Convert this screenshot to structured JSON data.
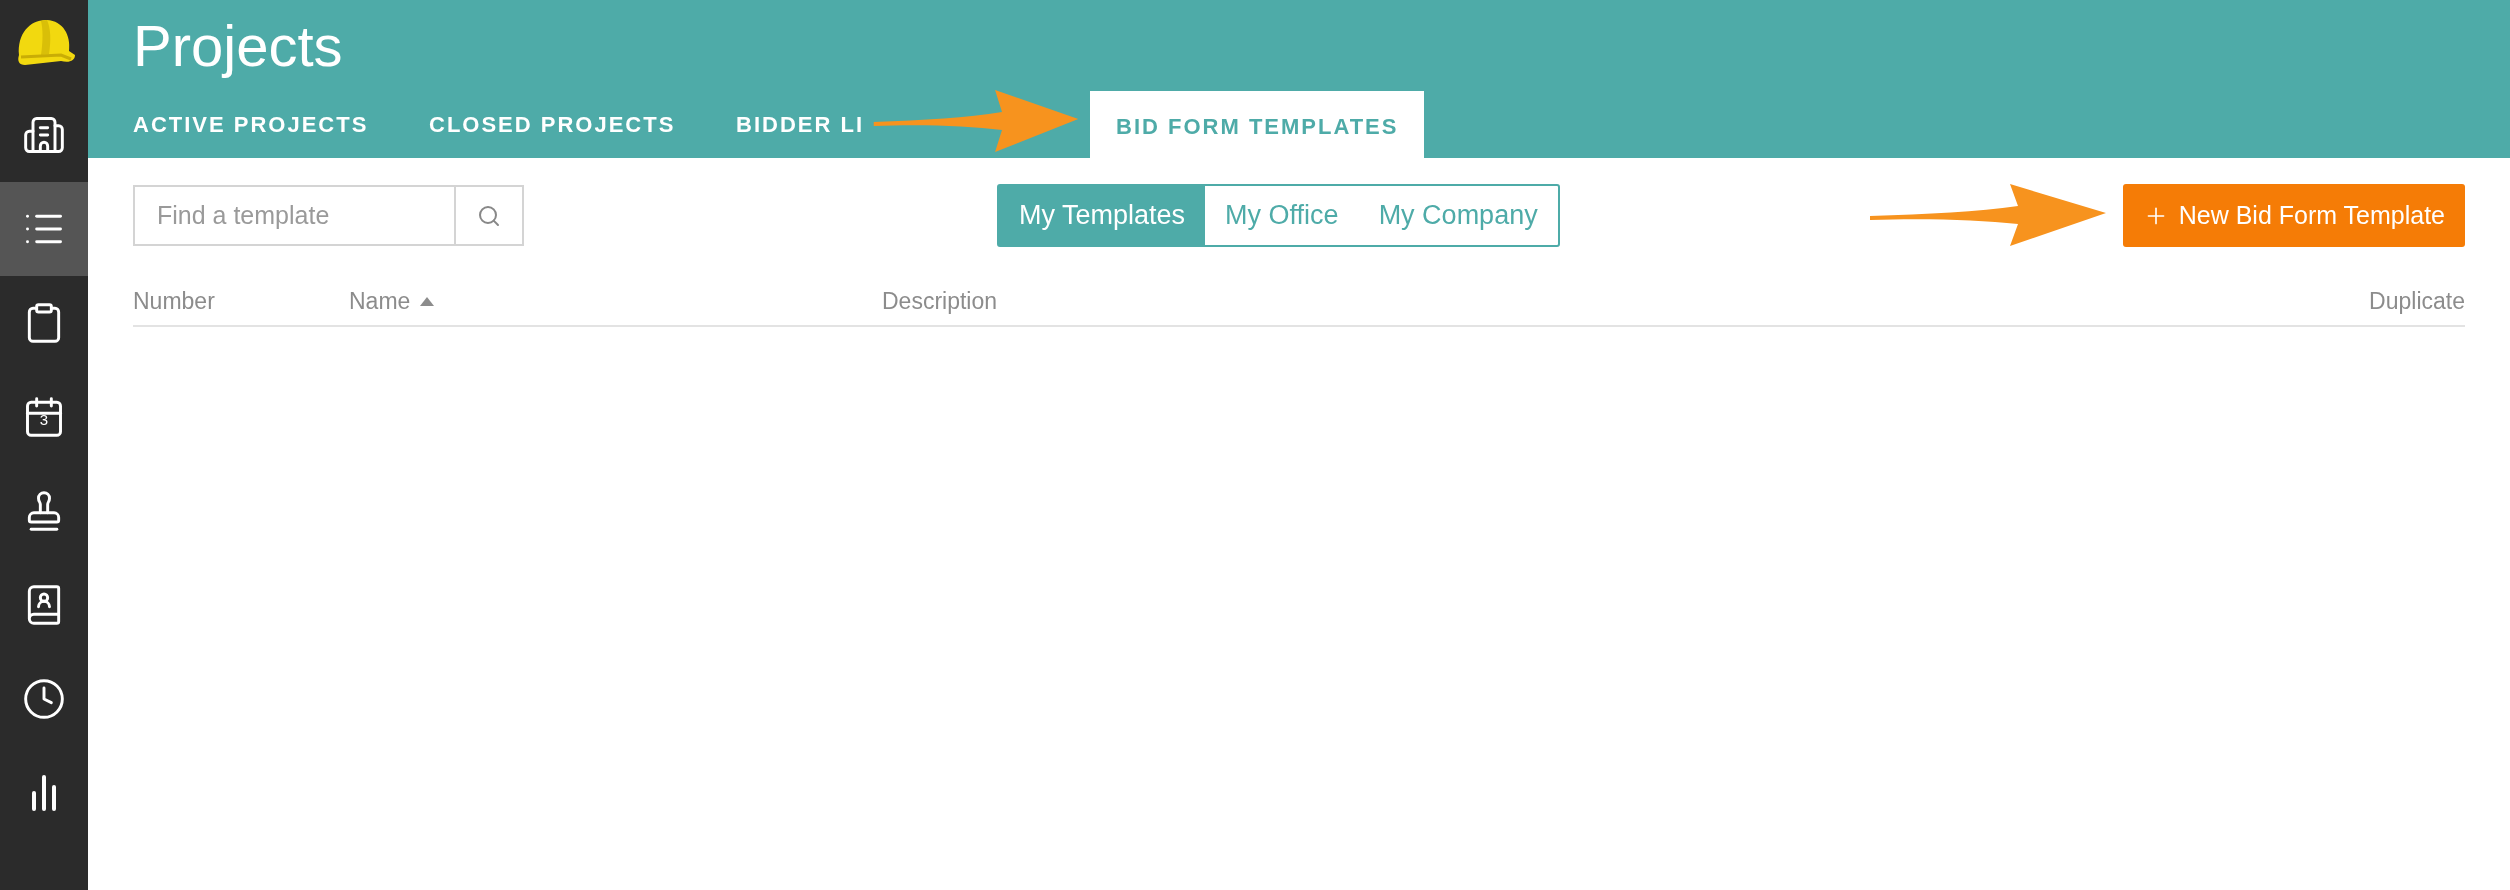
{
  "sidebar": {
    "items": [
      {
        "kind": "buildings",
        "selected": false
      },
      {
        "kind": "list",
        "selected": true
      },
      {
        "kind": "clipboard",
        "selected": false
      },
      {
        "kind": "calendar",
        "selected": false,
        "day": "3"
      },
      {
        "kind": "stamp",
        "selected": false
      },
      {
        "kind": "contacts",
        "selected": false
      },
      {
        "kind": "clock",
        "selected": false
      },
      {
        "kind": "chart",
        "selected": false
      }
    ]
  },
  "header": {
    "title": "Projects"
  },
  "tabs": [
    {
      "label": "ACTIVE PROJECTS",
      "selected": false
    },
    {
      "label": "CLOSED PROJECTS",
      "selected": false
    },
    {
      "label": "BIDDER LI",
      "selected": false
    },
    {
      "label": "BID FORM TEMPLATES",
      "selected": true
    }
  ],
  "search": {
    "placeholder": "Find a template"
  },
  "scope": [
    {
      "label": "My Templates",
      "selected": true
    },
    {
      "label": "My Office",
      "selected": false
    },
    {
      "label": "My Company",
      "selected": false
    }
  ],
  "new_button": {
    "label": "New Bid Form Template"
  },
  "table": {
    "columns": [
      {
        "label": "Number",
        "sorted": false
      },
      {
        "label": "Name",
        "sorted": true
      },
      {
        "label": "Description",
        "sorted": false
      },
      {
        "label": "Duplicate",
        "sorted": false
      }
    ]
  }
}
